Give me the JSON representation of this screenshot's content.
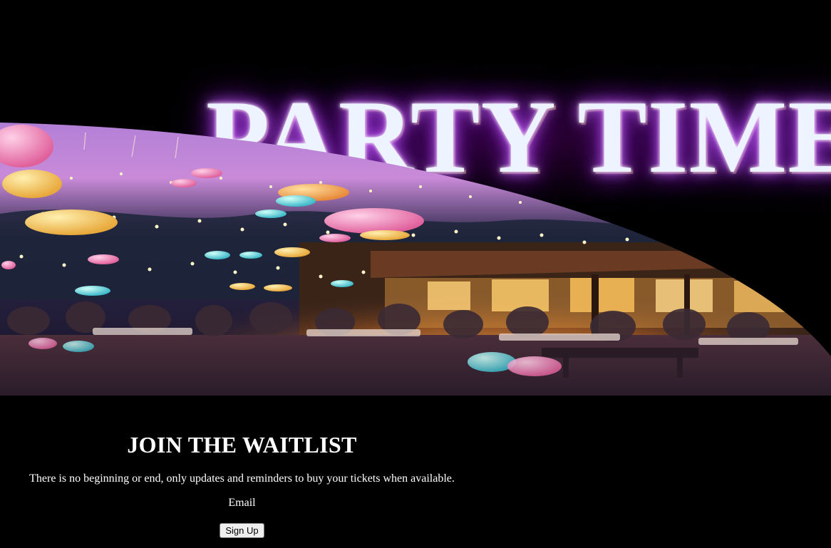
{
  "hero": {
    "title": "PARTY TIME",
    "image_alt": "party scene with balloons and string lights"
  },
  "waitlist": {
    "heading": "JOIN THE WAITLIST",
    "description": "There is no beginning or end, only updates and reminders to buy your tickets when available.",
    "email_label": "Email",
    "signup_label": "Sign Up"
  },
  "colors": {
    "background": "#000000",
    "title_text": "#eef4ff",
    "title_glow": "#8a1fd0",
    "body_text": "#ffffff"
  }
}
